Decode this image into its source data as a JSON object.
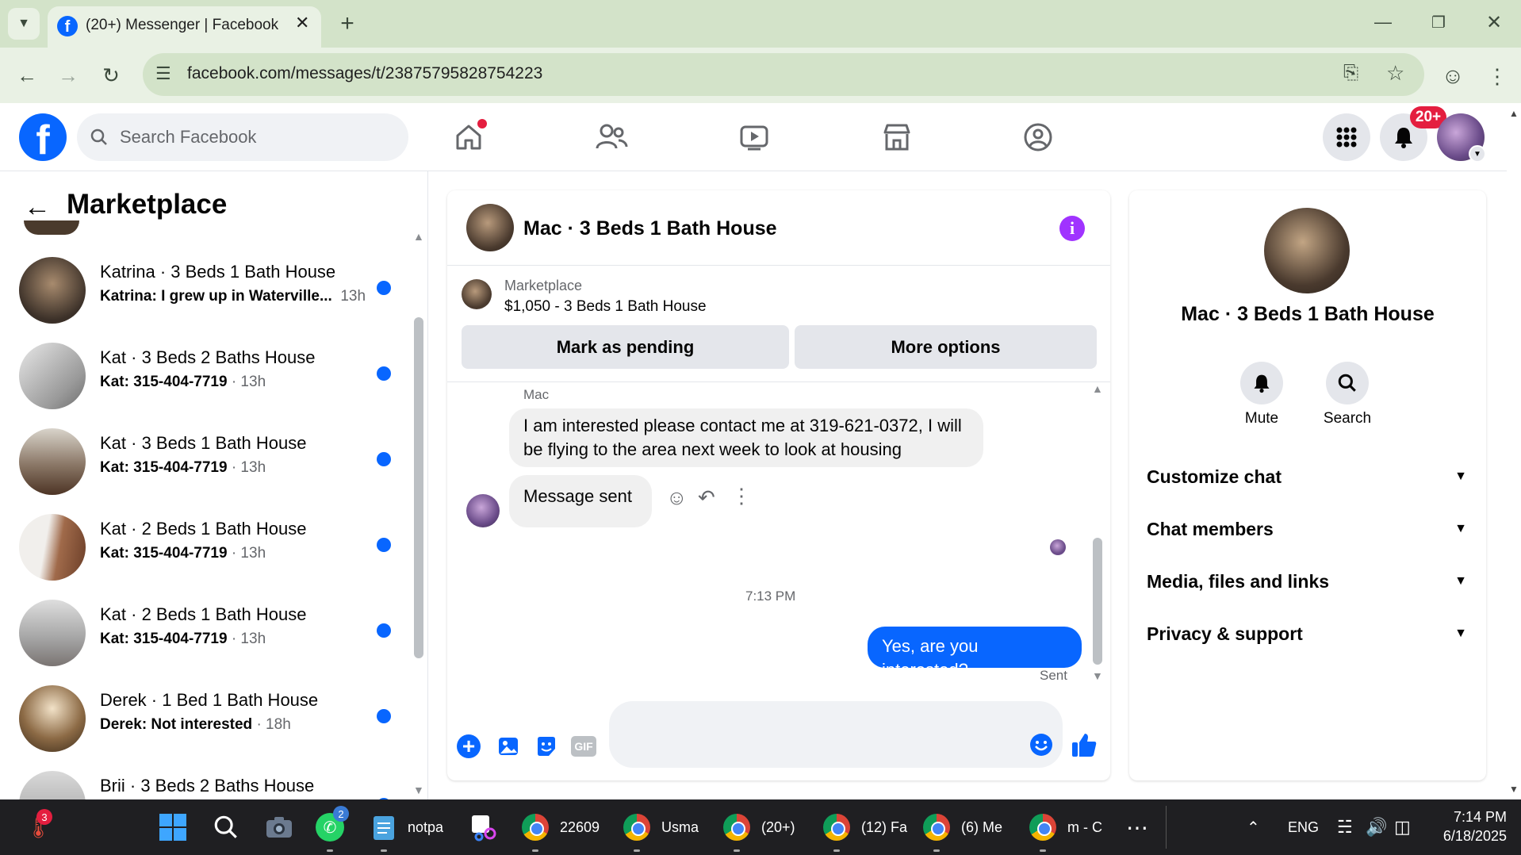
{
  "browser": {
    "tab_title": "(20+) Messenger | Facebook",
    "url": "facebook.com/messages/t/23875795828754223"
  },
  "fb": {
    "search_placeholder": "Search Facebook",
    "notification_badge": "20+"
  },
  "sidebar": {
    "title": "Marketplace",
    "conversations": [
      {
        "name": "Katrina · 3 Beds 1 Bath House",
        "preview": "Katrina: I grew up in Waterville...",
        "time": "13h"
      },
      {
        "name": "Kat · 3 Beds 2 Baths House",
        "preview": "Kat: 315-404-7719",
        "time": "· 13h"
      },
      {
        "name": "Kat · 3 Beds 1 Bath House",
        "preview": "Kat: 315-404-7719",
        "time": "· 13h"
      },
      {
        "name": "Kat · 2 Beds 1 Bath House",
        "preview": "Kat: 315-404-7719",
        "time": "· 13h"
      },
      {
        "name": "Kat · 2 Beds 1 Bath House",
        "preview": "Kat: 315-404-7719",
        "time": "· 13h"
      },
      {
        "name": "Derek · 1 Bed 1 Bath House",
        "preview": "Derek: Not interested",
        "time": "· 18h"
      },
      {
        "name": "Brii · 3 Beds 2 Baths House",
        "preview": "",
        "time": ""
      }
    ]
  },
  "chat": {
    "title": "Mac · 3 Beds 1 Bath House",
    "listing_source": "Marketplace",
    "listing_text": "$1,050 - 3 Beds 1 Bath House",
    "mark_pending": "Mark as pending",
    "more_options": "More options",
    "sender_name": "Mac",
    "incoming_message": "I am interested please contact me at 319-621-0372, I will be flying to the area next week to look at housing",
    "incoming_message_2": "Message sent",
    "timestamp": "7:13 PM",
    "outgoing_message": "Yes, are you interested?",
    "status": "Sent"
  },
  "right_panel": {
    "name": "Mac · 3 Beds 1 Bath House",
    "mute_label": "Mute",
    "search_label": "Search",
    "sections": [
      "Customize chat",
      "Chat members",
      "Media, files and links",
      "Privacy & support"
    ]
  },
  "taskbar": {
    "weather_badge": "3",
    "whatsapp_badge": "2",
    "notepad_label": "notpa",
    "chrome_items": [
      "22609",
      "Usma",
      "(20+)",
      "(12) Fa",
      "(6) Me",
      "m - C"
    ],
    "language": "ENG",
    "time": "7:14 PM",
    "date": "6/18/2025"
  },
  "colors": {
    "fb_blue": "#0866ff",
    "chrome_frame": "#d3e3c9",
    "info_purple": "#a033ff",
    "badge_red": "#e41e3f"
  }
}
